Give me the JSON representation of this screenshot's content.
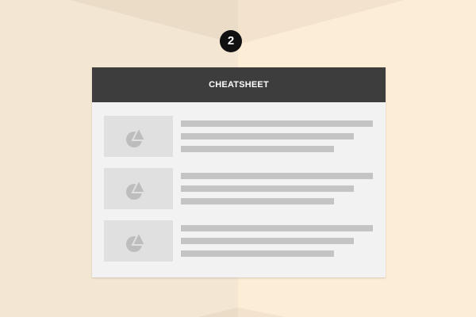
{
  "step_badge": "2",
  "window": {
    "title": "CHEATSHEET"
  },
  "list": {
    "items": [
      {
        "thumbnail_icon": "shapes-icon"
      },
      {
        "thumbnail_icon": "shapes-icon"
      },
      {
        "thumbnail_icon": "shapes-icon"
      }
    ]
  },
  "colors": {
    "background_left": "#f3e7d3",
    "background_right": "#fcedd7",
    "titlebar": "#3d3d3d",
    "window_body": "#f2f2f2",
    "placeholder": "#c4c4c4",
    "badge": "#111111"
  }
}
